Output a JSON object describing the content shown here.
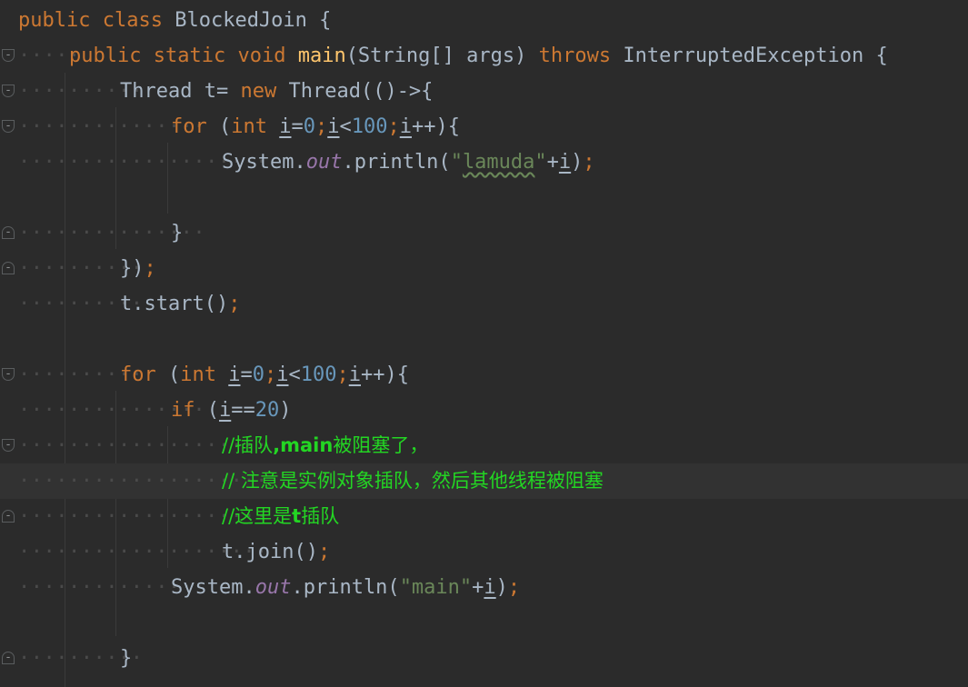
{
  "editor": {
    "theme_colors": {
      "background": "#2b2b2b",
      "keyword": "#cc7832",
      "identifier": "#a9b7c6",
      "method": "#ffc66d",
      "number": "#6897bb",
      "string": "#6a8759",
      "field": "#9876aa",
      "comment": "#23d623",
      "current_line": "#323232"
    },
    "lines": {
      "l1": {
        "kw1": "public",
        "kw2": "class",
        "name": "BlockedJoin",
        "brace": "{"
      },
      "l2": {
        "kw1": "public",
        "kw2": "static",
        "kw3": "void",
        "method": "main",
        "params": "(String[] args) ",
        "throws": "throws",
        "exc": "InterruptedException",
        "brace": "{"
      },
      "l3": {
        "type": "Thread",
        "assign": "t= ",
        "kw": "new",
        "rest": "Thread(()->{"
      },
      "l4": {
        "kw": "for",
        "open": "(",
        "kwint": "int",
        "i1": "i",
        "eq": "=",
        "n0": "0",
        "semi1": ";",
        "i2": "i",
        "lt": "<",
        "n100": "100",
        "semi2": ";",
        "i3": "i",
        "inc": "++){"
      },
      "l5": {
        "obj": "System.",
        "field": "out",
        "call": ".println(",
        "q1": "\"",
        "str": "lamuda",
        "q2": "\"",
        "plus": "+",
        "i": "i",
        "close": ")",
        "semi": ";"
      },
      "l7": {
        "brace": "}"
      },
      "l8": {
        "close": "})",
        "semi": ";"
      },
      "l9": {
        "stmt": "t.start()",
        "semi": ";"
      },
      "l11": {
        "kw": "for",
        "open": "(",
        "kwint": "int",
        "i1": "i",
        "eq": "=",
        "n0": "0",
        "semi1": ";",
        "i2": "i",
        "lt": "<",
        "n100": "100",
        "semi2": ";",
        "i3": "i",
        "inc": "++){"
      },
      "l12": {
        "kw": "if",
        "open": "(",
        "i": "i",
        "eqeq": "==",
        "n20": "20",
        "close": ")"
      },
      "l13": {
        "slashes": "//插队",
        "bold": ",main",
        "tail": "被阻塞了，"
      },
      "l14": {
        "text": "// 注意是实例对象插队，然后其他线程被阻塞"
      },
      "l15": {
        "head": "//这里是",
        "bold": "t",
        "tail": "插队"
      },
      "l16": {
        "stmt": "t.join()",
        "semi": ";"
      },
      "l17": {
        "obj": "System.",
        "field": "out",
        "call": ".println(",
        "str": "\"main\"",
        "plus": "+",
        "i": "i",
        "close": ")",
        "semi": ";"
      },
      "l19": {
        "brace": "}"
      }
    }
  }
}
